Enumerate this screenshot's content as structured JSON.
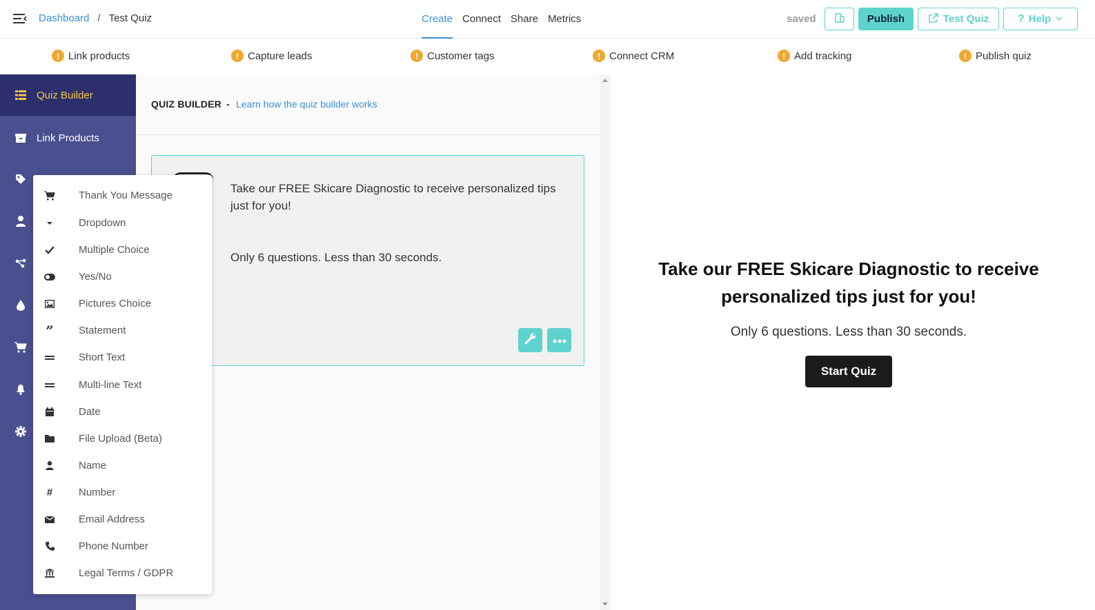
{
  "header": {
    "breadcrumb": {
      "root": "Dashboard",
      "separator": "/",
      "current": "Test Quiz"
    },
    "tabs": [
      {
        "label": "Create",
        "active": true
      },
      {
        "label": "Connect",
        "active": false
      },
      {
        "label": "Share",
        "active": false
      },
      {
        "label": "Metrics",
        "active": false
      }
    ],
    "status": "saved",
    "publish_label": "Publish",
    "test_label": "Test Quiz",
    "help_label": "Help"
  },
  "checklist": [
    {
      "label": "Link products"
    },
    {
      "label": "Capture leads"
    },
    {
      "label": "Customer tags"
    },
    {
      "label": "Connect CRM"
    },
    {
      "label": "Add tracking"
    },
    {
      "label": "Publish quiz"
    }
  ],
  "sidebar": {
    "items": [
      {
        "label": "Quiz Builder",
        "icon": "list-icon",
        "active": true
      },
      {
        "label": "Link Products",
        "icon": "box-icon",
        "active": false
      }
    ],
    "icon_only": [
      "tag-icon",
      "user-icon",
      "share-icon",
      "drop-icon",
      "cart-icon",
      "bell-icon",
      "gear-icon"
    ]
  },
  "builder": {
    "title": "QUIZ BUILDER",
    "dash": "-",
    "link": "Learn how the quiz builder works",
    "card": {
      "text": "Take our FREE Skicare Diagnostic to receive personalized tips just for you!",
      "sub": "Only 6 questions. Less than 30 seconds."
    }
  },
  "preview": {
    "title_prefix": "Take our ",
    "title_bold": "FREE",
    "title_suffix": " Skicare Diagnostic to receive personalized tips just for you!",
    "sub": "Only 6 questions. Less than 30 seconds.",
    "start": "Start Quiz"
  },
  "dropdown": {
    "items": [
      {
        "label": "Thank You Message",
        "icon": "cart-icon"
      },
      {
        "label": "Dropdown",
        "icon": "caret-down-icon"
      },
      {
        "label": "Multiple Choice",
        "icon": "check-icon"
      },
      {
        "label": "Yes/No",
        "icon": "toggle-icon"
      },
      {
        "label": "Pictures Choice",
        "icon": "image-icon"
      },
      {
        "label": "Statement",
        "icon": "quote-icon"
      },
      {
        "label": "Short Text",
        "icon": "equals-icon"
      },
      {
        "label": "Multi-line Text",
        "icon": "equals-icon"
      },
      {
        "label": "Date",
        "icon": "calendar-icon"
      },
      {
        "label": "File Upload (Beta)",
        "icon": "folder-icon"
      },
      {
        "label": "Name",
        "icon": "user-icon"
      },
      {
        "label": "Number",
        "icon": "hash-icon"
      },
      {
        "label": "Email Address",
        "icon": "envelope-icon"
      },
      {
        "label": "Phone Number",
        "icon": "phone-icon"
      },
      {
        "label": "Legal Terms / GDPR",
        "icon": "bank-icon"
      }
    ]
  },
  "colors": {
    "accent": "#5ed3cd",
    "link": "#3a8fd9",
    "sidebar": "#4a4f8f",
    "sidebar_active": "#2c2f6b",
    "sidebar_active_text": "#f5c842",
    "warning": "#f0a830"
  }
}
